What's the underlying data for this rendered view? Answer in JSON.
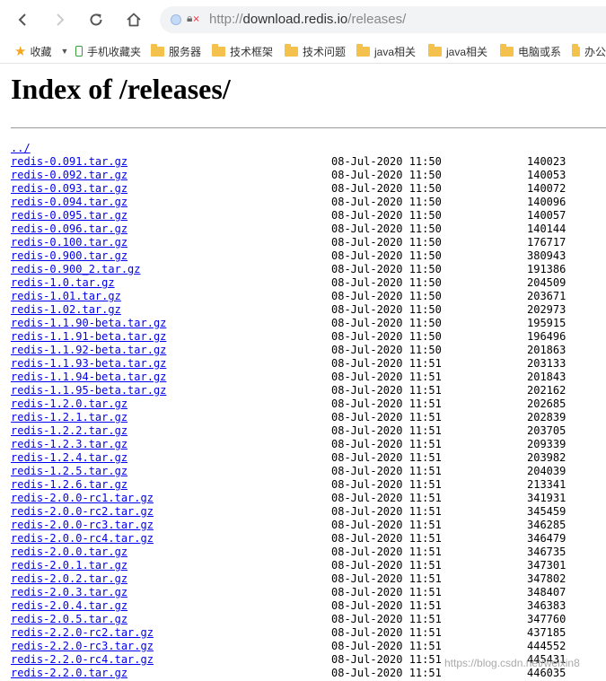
{
  "browser": {
    "url_scheme": "http://",
    "url_host": "download.redis.io",
    "url_path": "/releases/",
    "icons": [
      "back-icon",
      "forward-icon",
      "reload-icon",
      "home-icon",
      "site-info-icon",
      "not-secure-icon",
      "star-icon",
      "phone-icon",
      "folder-icon"
    ]
  },
  "bookmarks": {
    "items": [
      {
        "label": "收藏",
        "icon": "star-icon"
      },
      {
        "label": "手机收藏夹",
        "icon": "phone-icon"
      },
      {
        "label": "服务器",
        "icon": "folder-icon"
      },
      {
        "label": "技术框架",
        "icon": "folder-icon"
      },
      {
        "label": "技术问题",
        "icon": "folder-icon"
      },
      {
        "label": "java相关",
        "icon": "folder-icon"
      },
      {
        "label": "java相关",
        "icon": "folder-icon"
      },
      {
        "label": "电脑或系",
        "icon": "folder-icon"
      },
      {
        "label": "办公",
        "icon": "folder-icon"
      }
    ]
  },
  "page": {
    "title": "Index of /releases/",
    "parent_link": "../",
    "entries": [
      {
        "name": "redis-0.091.tar.gz",
        "date": "08-Jul-2020 11:50",
        "size": "140023"
      },
      {
        "name": "redis-0.092.tar.gz",
        "date": "08-Jul-2020 11:50",
        "size": "140053"
      },
      {
        "name": "redis-0.093.tar.gz",
        "date": "08-Jul-2020 11:50",
        "size": "140072"
      },
      {
        "name": "redis-0.094.tar.gz",
        "date": "08-Jul-2020 11:50",
        "size": "140096"
      },
      {
        "name": "redis-0.095.tar.gz",
        "date": "08-Jul-2020 11:50",
        "size": "140057"
      },
      {
        "name": "redis-0.096.tar.gz",
        "date": "08-Jul-2020 11:50",
        "size": "140144"
      },
      {
        "name": "redis-0.100.tar.gz",
        "date": "08-Jul-2020 11:50",
        "size": "176717"
      },
      {
        "name": "redis-0.900.tar.gz",
        "date": "08-Jul-2020 11:50",
        "size": "380943"
      },
      {
        "name": "redis-0.900_2.tar.gz",
        "date": "08-Jul-2020 11:50",
        "size": "191386"
      },
      {
        "name": "redis-1.0.tar.gz",
        "date": "08-Jul-2020 11:50",
        "size": "204509"
      },
      {
        "name": "redis-1.01.tar.gz",
        "date": "08-Jul-2020 11:50",
        "size": "203671"
      },
      {
        "name": "redis-1.02.tar.gz",
        "date": "08-Jul-2020 11:50",
        "size": "202973"
      },
      {
        "name": "redis-1.1.90-beta.tar.gz",
        "date": "08-Jul-2020 11:50",
        "size": "195915"
      },
      {
        "name": "redis-1.1.91-beta.tar.gz",
        "date": "08-Jul-2020 11:50",
        "size": "196496"
      },
      {
        "name": "redis-1.1.92-beta.tar.gz",
        "date": "08-Jul-2020 11:50",
        "size": "201863"
      },
      {
        "name": "redis-1.1.93-beta.tar.gz",
        "date": "08-Jul-2020 11:51",
        "size": "203133"
      },
      {
        "name": "redis-1.1.94-beta.tar.gz",
        "date": "08-Jul-2020 11:51",
        "size": "201843"
      },
      {
        "name": "redis-1.1.95-beta.tar.gz",
        "date": "08-Jul-2020 11:51",
        "size": "202162"
      },
      {
        "name": "redis-1.2.0.tar.gz",
        "date": "08-Jul-2020 11:51",
        "size": "202685"
      },
      {
        "name": "redis-1.2.1.tar.gz",
        "date": "08-Jul-2020 11:51",
        "size": "202839"
      },
      {
        "name": "redis-1.2.2.tar.gz",
        "date": "08-Jul-2020 11:51",
        "size": "203705"
      },
      {
        "name": "redis-1.2.3.tar.gz",
        "date": "08-Jul-2020 11:51",
        "size": "209339"
      },
      {
        "name": "redis-1.2.4.tar.gz",
        "date": "08-Jul-2020 11:51",
        "size": "203982"
      },
      {
        "name": "redis-1.2.5.tar.gz",
        "date": "08-Jul-2020 11:51",
        "size": "204039"
      },
      {
        "name": "redis-1.2.6.tar.gz",
        "date": "08-Jul-2020 11:51",
        "size": "213341"
      },
      {
        "name": "redis-2.0.0-rc1.tar.gz",
        "date": "08-Jul-2020 11:51",
        "size": "341931"
      },
      {
        "name": "redis-2.0.0-rc2.tar.gz",
        "date": "08-Jul-2020 11:51",
        "size": "345459"
      },
      {
        "name": "redis-2.0.0-rc3.tar.gz",
        "date": "08-Jul-2020 11:51",
        "size": "346285"
      },
      {
        "name": "redis-2.0.0-rc4.tar.gz",
        "date": "08-Jul-2020 11:51",
        "size": "346479"
      },
      {
        "name": "redis-2.0.0.tar.gz",
        "date": "08-Jul-2020 11:51",
        "size": "346735"
      },
      {
        "name": "redis-2.0.1.tar.gz",
        "date": "08-Jul-2020 11:51",
        "size": "347301"
      },
      {
        "name": "redis-2.0.2.tar.gz",
        "date": "08-Jul-2020 11:51",
        "size": "347802"
      },
      {
        "name": "redis-2.0.3.tar.gz",
        "date": "08-Jul-2020 11:51",
        "size": "348407"
      },
      {
        "name": "redis-2.0.4.tar.gz",
        "date": "08-Jul-2020 11:51",
        "size": "346383"
      },
      {
        "name": "redis-2.0.5.tar.gz",
        "date": "08-Jul-2020 11:51",
        "size": "347760"
      },
      {
        "name": "redis-2.2.0-rc2.tar.gz",
        "date": "08-Jul-2020 11:51",
        "size": "437185"
      },
      {
        "name": "redis-2.2.0-rc3.tar.gz",
        "date": "08-Jul-2020 11:51",
        "size": "444552"
      },
      {
        "name": "redis-2.2.0-rc4.tar.gz",
        "date": "08-Jul-2020 11:51",
        "size": "445431"
      },
      {
        "name": "redis-2.2.0.tar.gz",
        "date": "08-Jul-2020 11:51",
        "size": "446035"
      }
    ]
  },
  "watermark": "https://blog.csdn.net/weixin8",
  "colors": {
    "link": "#0000ee",
    "text": "#000000",
    "folder": "#f4c14c",
    "star": "#f5a623"
  }
}
